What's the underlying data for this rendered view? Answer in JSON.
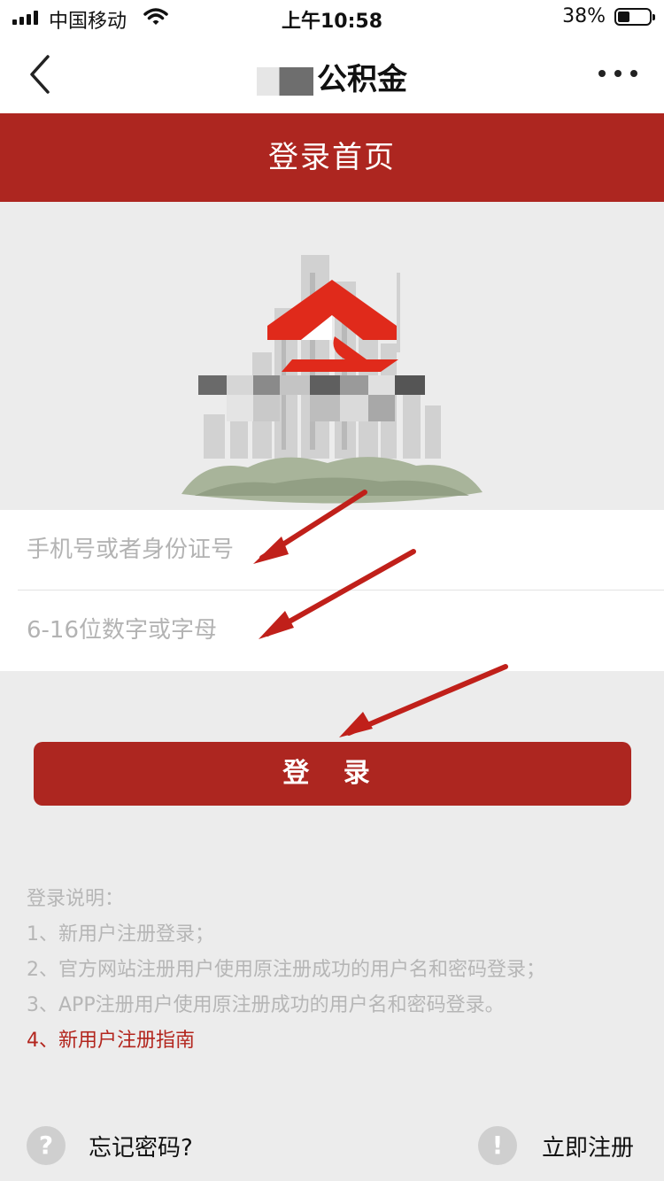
{
  "status_bar": {
    "carrier": "中国移动",
    "time": "上午10:58",
    "battery": "38%",
    "signal_icon": "signal-bars-icon",
    "wifi_icon": "wifi-icon",
    "battery_icon": "battery-icon",
    "battery_level": 0.38
  },
  "nav": {
    "title": "公积金",
    "back_icon": "chevron-left-icon",
    "more_icon": "more-dots-icon"
  },
  "header": {
    "title": "登录首页"
  },
  "form": {
    "account_placeholder": "手机号或者身份证号",
    "password_placeholder": "6-16位数字或字母"
  },
  "login_button": "登 录",
  "instructions": {
    "heading": "登录说明：",
    "items": [
      "1、新用户注册登录；",
      "2、官方网站注册用户使用原注册成功的用户名和密码登录；",
      "3、APP注册用户使用原注册成功的用户名和密码登录。"
    ],
    "guide_link": "4、新用户注册指南"
  },
  "bottom": {
    "forgot_password": "忘记密码?",
    "register": "立即注册",
    "help_icon": "question-icon",
    "info_icon": "exclamation-icon"
  },
  "colors": {
    "brand_red": "#ad2620",
    "link_red": "#b3261e",
    "background": "#ececec",
    "annotation_arrow": "#c0201a"
  }
}
